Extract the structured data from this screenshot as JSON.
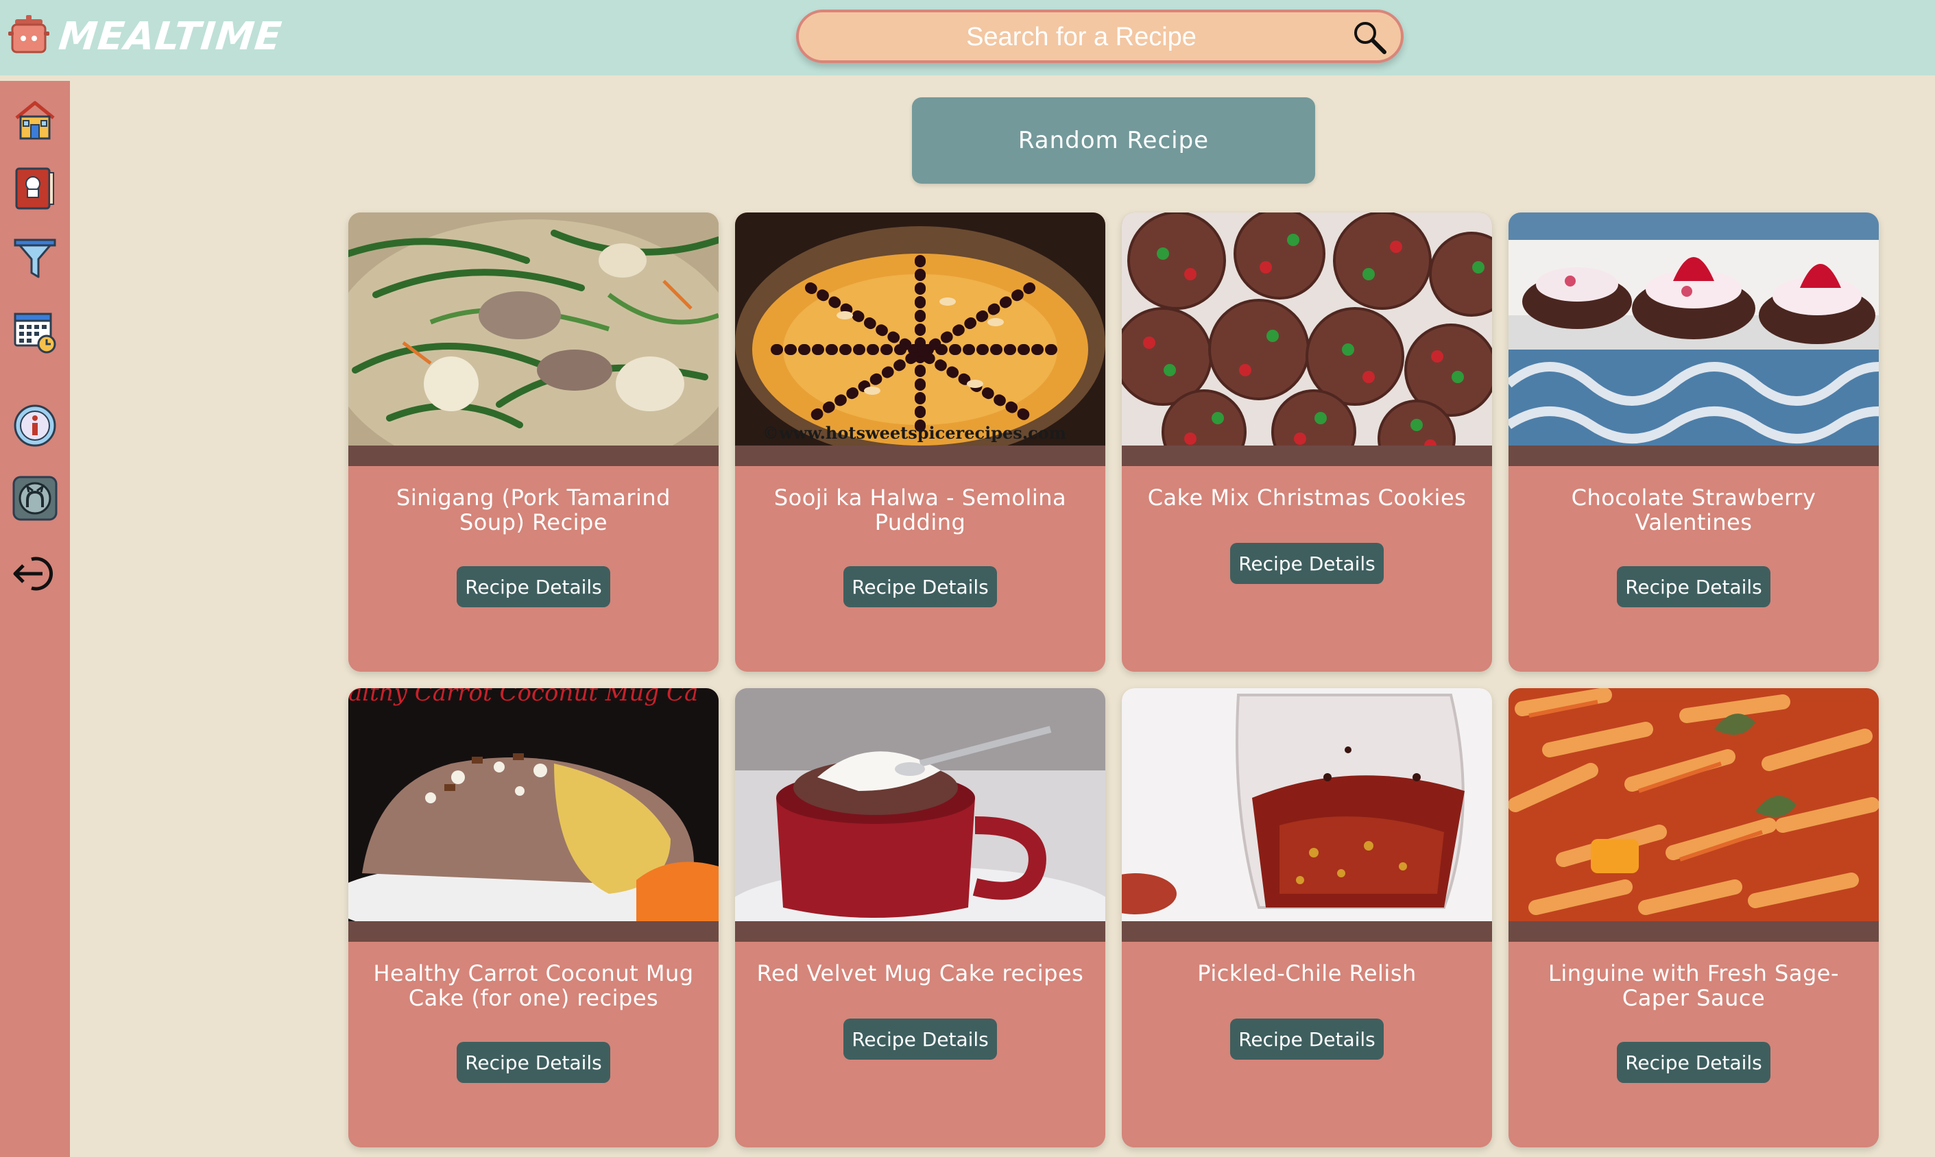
{
  "app": {
    "title": "MEALTIME",
    "logo_icon": "pot-icon"
  },
  "search": {
    "placeholder": "Search for a Recipe",
    "icon": "magnifier-icon"
  },
  "sidebar": {
    "items": [
      {
        "icon": "home-icon"
      },
      {
        "icon": "recipe-book-icon"
      },
      {
        "icon": "filter-icon"
      },
      {
        "icon": "calendar-icon"
      },
      {
        "icon": "info-icon"
      },
      {
        "icon": "github-icon"
      },
      {
        "icon": "logout-icon"
      }
    ]
  },
  "random_button": {
    "label": "Random Recipe"
  },
  "cards": [
    {
      "title": "Sinigang (Pork Tamarind Soup) Recipe",
      "button": "Recipe Details",
      "image": "sinigang-soup"
    },
    {
      "title": "Sooji ka Halwa - Semolina Pudding",
      "button": "Recipe Details",
      "image": "halwa-pudding",
      "watermark": "©www.hotsweetspicerecipes.com"
    },
    {
      "title": "Cake Mix Christmas Cookies",
      "button": "Recipe Details",
      "image": "christmas-cookies"
    },
    {
      "title": "Chocolate Strawberry Valentines",
      "button": "Recipe Details",
      "image": "strawberry-valentines"
    },
    {
      "title": "Healthy Carrot Coconut Mug Cake (for one) recipes",
      "button": "Recipe Details",
      "image": "carrot-mug-cake",
      "overlay": "althy Carrot Coconut Mug Ca"
    },
    {
      "title": "Red Velvet Mug Cake recipes",
      "button": "Recipe Details",
      "image": "red-velvet-mug-cake"
    },
    {
      "title": "Pickled-Chile Relish",
      "button": "Recipe Details",
      "image": "chile-relish"
    },
    {
      "title": "Linguine with Fresh Sage-Caper Sauce",
      "button": "Recipe Details",
      "image": "penne-pasta"
    }
  ],
  "colors": {
    "header": "#bee0d7",
    "background": "#ebe3cf",
    "sidebar": "#d5857a",
    "card": "#d5857a",
    "card_strip": "#6e4a44",
    "button": "#3f5f5f",
    "random_button": "#74999a",
    "search_fill": "#f3c7a2"
  }
}
